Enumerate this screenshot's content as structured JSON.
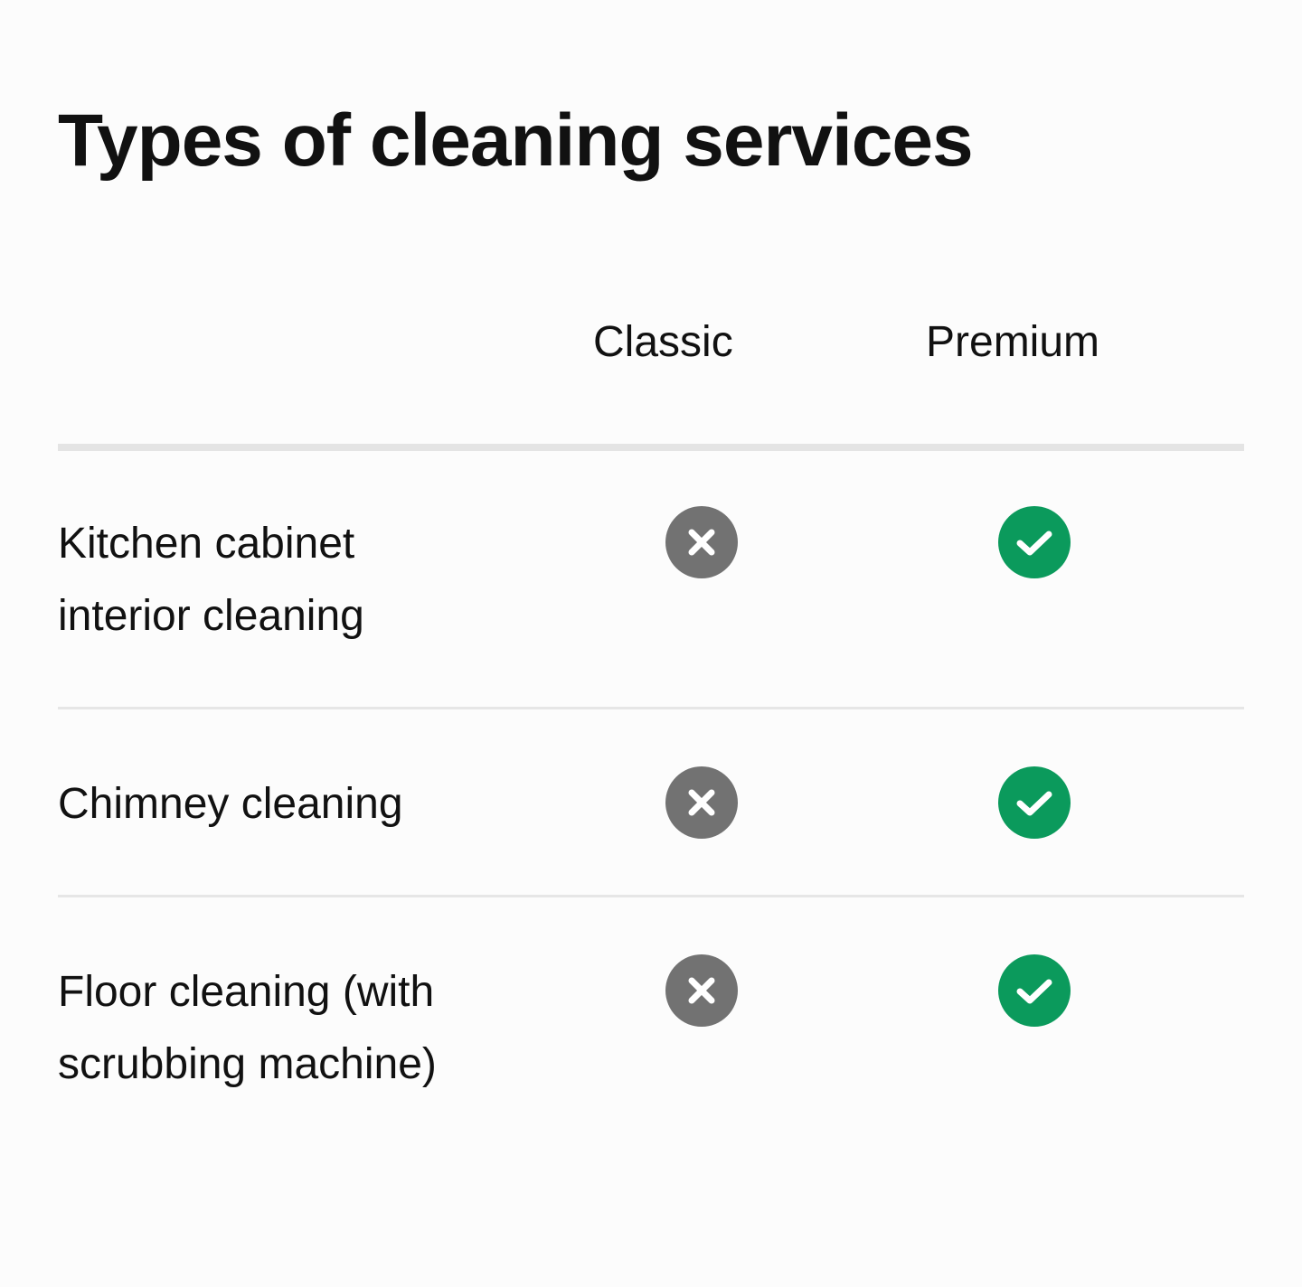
{
  "title": "Types of cleaning services",
  "columns": {
    "classic": "Classic",
    "premium": "Premium"
  },
  "colors": {
    "not_included": "#727272",
    "included": "#0b9a5c",
    "divider": "#e4e4e4"
  },
  "rows": [
    {
      "label": "Kitchen cabinet interior cleaning",
      "classic": "not-included",
      "premium": "included"
    },
    {
      "label": "Chimney cleaning",
      "classic": "not-included",
      "premium": "included"
    },
    {
      "label": "Floor cleaning (with scrubbing machine)",
      "classic": "not-included",
      "premium": "included"
    }
  ],
  "icons": {
    "not_included": "x-circle-icon",
    "included": "check-circle-icon"
  }
}
